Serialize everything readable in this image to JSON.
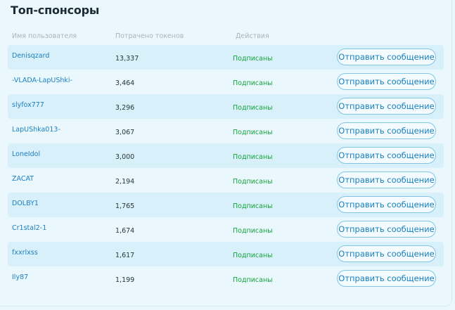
{
  "title": "Топ-спонсоры",
  "columns": {
    "user": "Имя пользователя",
    "tokens": "Потрачено токенов",
    "actions": "Действия"
  },
  "rows": [
    {
      "user": "Denisqzard",
      "tokens": "13,337",
      "status": "Подписаны",
      "button": "Отправить сообщение"
    },
    {
      "user": "-VLADA-LapUShki-",
      "tokens": "3,464",
      "status": "Подписаны",
      "button": "Отправить сообщение"
    },
    {
      "user": "slyfox777",
      "tokens": "3,296",
      "status": "Подписаны",
      "button": "Отправить сообщение"
    },
    {
      "user": "LapUShka013-",
      "tokens": "3,067",
      "status": "Подписаны",
      "button": "Отправить сообщение"
    },
    {
      "user": "LoneIdol",
      "tokens": "3,000",
      "status": "Подписаны",
      "button": "Отправить сообщение"
    },
    {
      "user": "ZACAT",
      "tokens": "2,194",
      "status": "Подписаны",
      "button": "Отправить сообщение"
    },
    {
      "user": "DOLBY1",
      "tokens": "1,765",
      "status": "Подписаны",
      "button": "Отправить сообщение"
    },
    {
      "user": "Cr1stal2-1",
      "tokens": "1,674",
      "status": "Подписаны",
      "button": "Отправить сообщение"
    },
    {
      "user": "fxxrlxss",
      "tokens": "1,617",
      "status": "Подписаны",
      "button": "Отправить сообщение"
    },
    {
      "user": "Ily87",
      "tokens": "1,199",
      "status": "Подписаны",
      "button": "Отправить сообщение"
    }
  ],
  "colors": {
    "accent": "#1780bf",
    "status": "#17a43c",
    "row_shade": "#d8f0f9"
  }
}
